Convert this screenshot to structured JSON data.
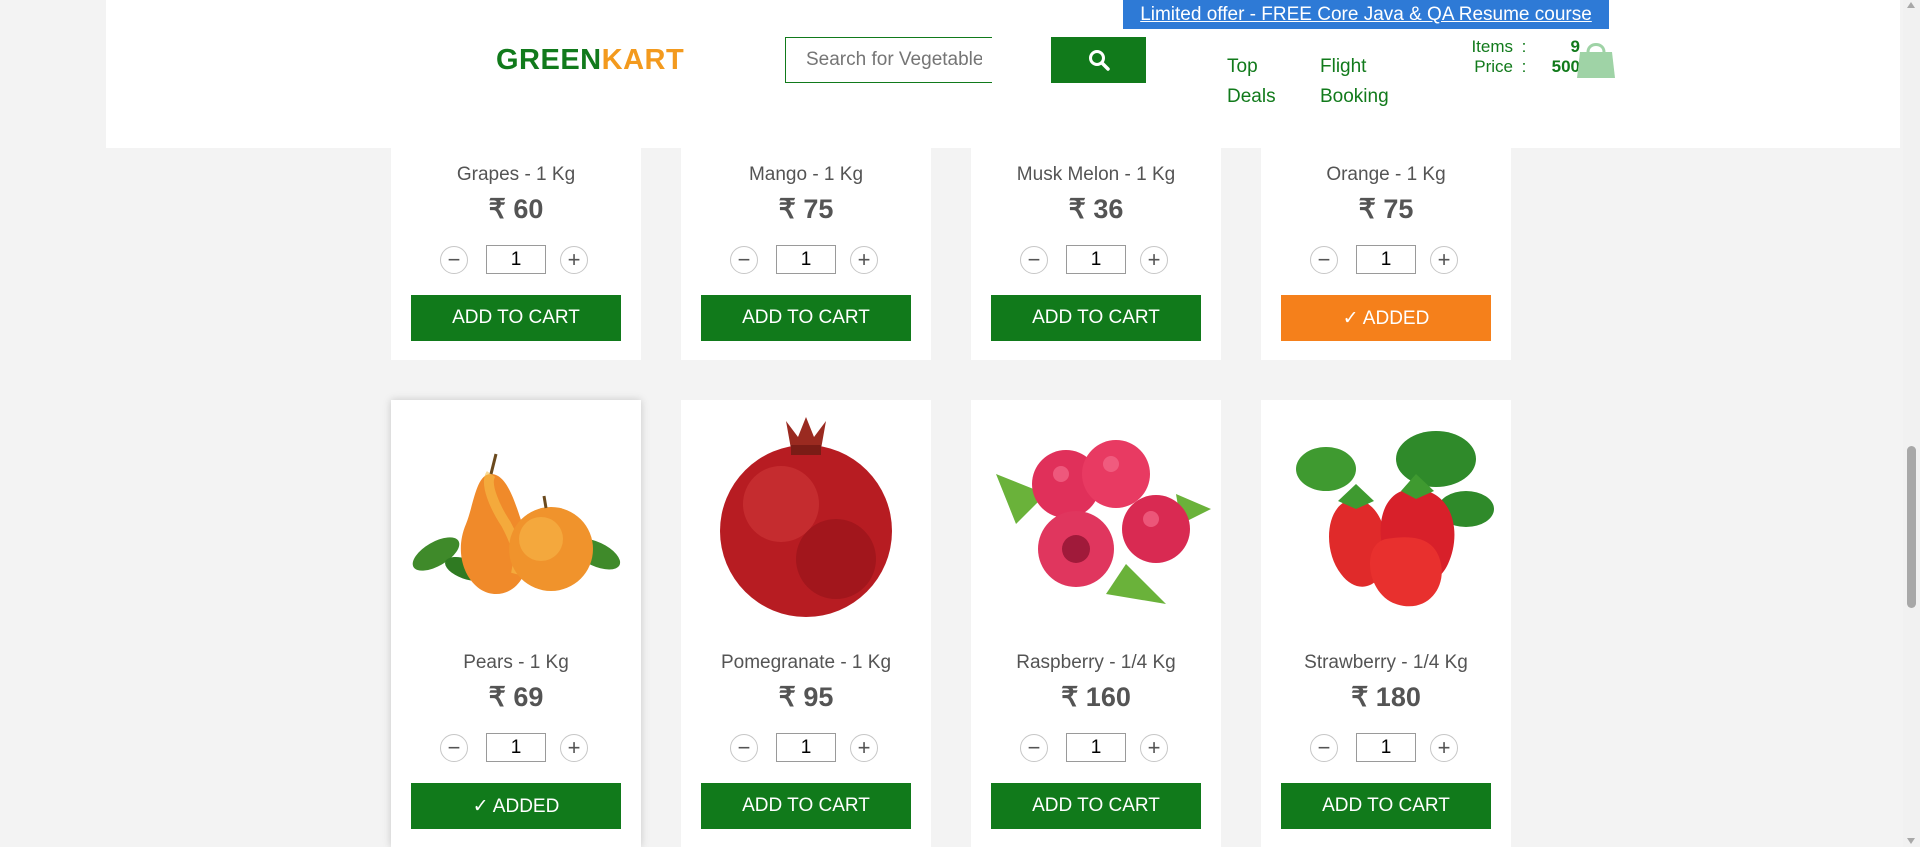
{
  "header": {
    "logo_green": "GREEN",
    "logo_orange": "KART",
    "search_placeholder": "Search for Vegetables and Fruits",
    "nav": [
      {
        "line1": "Top",
        "line2": "Deals"
      },
      {
        "line1": "Flight",
        "line2": "Booking"
      }
    ],
    "cart": {
      "items_label": "Items",
      "items_value": "9",
      "price_label": "Price",
      "price_value": "500",
      "separator": ":"
    },
    "offer": "Limited offer - FREE Core Java & QA Resume course"
  },
  "colors": {
    "brand_green": "#117a1b",
    "brand_orange": "#f39a1e",
    "added_orange": "#f5801b",
    "offer_blue": "#2e7ad6"
  },
  "products_row1": [
    {
      "name": "Grapes - 1 Kg",
      "price": "₹ 60",
      "qty": "1",
      "button": "ADD TO CART"
    },
    {
      "name": "Mango - 1 Kg",
      "price": "₹ 75",
      "qty": "1",
      "button": "ADD TO CART"
    },
    {
      "name": "Musk Melon - 1 Kg",
      "price": "₹ 36",
      "qty": "1",
      "button": "ADD TO CART"
    },
    {
      "name": "Orange - 1 Kg",
      "price": "₹ 75",
      "qty": "1",
      "button": "✓ ADDED"
    }
  ],
  "products_row2": [
    {
      "name": "Pears - 1 Kg",
      "price": "₹ 69",
      "qty": "1",
      "button": "✓ ADDED"
    },
    {
      "name": "Pomegranate - 1 Kg",
      "price": "₹ 95",
      "qty": "1",
      "button": "ADD TO CART"
    },
    {
      "name": "Raspberry - 1/4 Kg",
      "price": "₹ 160",
      "qty": "1",
      "button": "ADD TO CART"
    },
    {
      "name": "Strawberry - 1/4 Kg",
      "price": "₹ 180",
      "qty": "1",
      "button": "ADD TO CART"
    }
  ],
  "icons": {
    "search": "search-icon",
    "cart": "shopping-bag-icon",
    "minus": "minus-icon",
    "plus": "plus-icon"
  }
}
